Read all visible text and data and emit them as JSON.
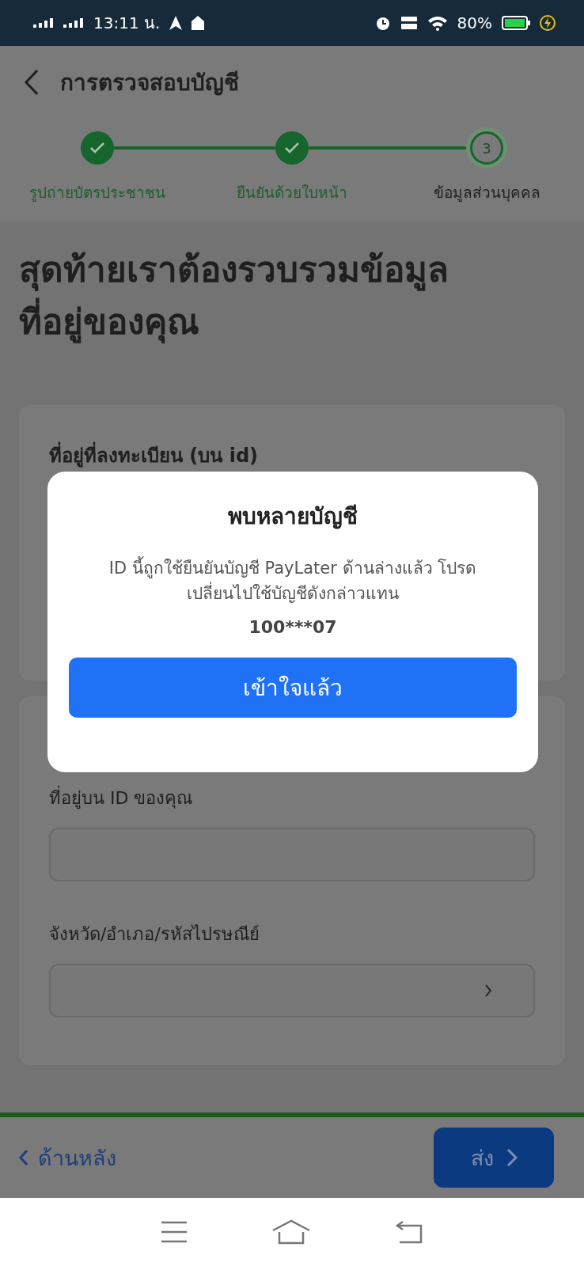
{
  "status_bar": {
    "time": "13:11 น.",
    "battery": "80%"
  },
  "header": {
    "title": "การตรวจสอบบัญชี"
  },
  "stepper": [
    {
      "label": "รูปถ่ายบัตรประชาชน",
      "completed": true
    },
    {
      "label": "ยืนยันด้วยใบหน้า",
      "completed": true
    },
    {
      "label": "ข้อมูลส่วนบุคคล",
      "completed": false,
      "number": "3"
    }
  ],
  "heading": [
    "สุดท้ายเราต้องรวบรวมข้อมูล",
    "ที่อยู่ของคุณ"
  ],
  "registered_address": {
    "title": "ที่อยู่ที่ลงทะเบียน (บน id)"
  },
  "address_fields": [
    {
      "label": "ที่อยู่บน ID ของคุณ",
      "kind": "text"
    },
    {
      "label": "จังหวัด/อำเภอ/รหัสไปรษณีย์",
      "kind": "select"
    }
  ],
  "footer": {
    "back": "ด้านหลัง",
    "submit": "ส่ง"
  },
  "dialog": {
    "title": "พบหลายบัญชี",
    "message": "ID นี้ถูกใช้ยืนยันบัญชี PayLater ด้านล่างแล้ว โปรดเปลี่ยนไปใช้บัญชีดังกล่าวแทน",
    "account": "100***07",
    "button": "เข้าใจแล้ว"
  }
}
